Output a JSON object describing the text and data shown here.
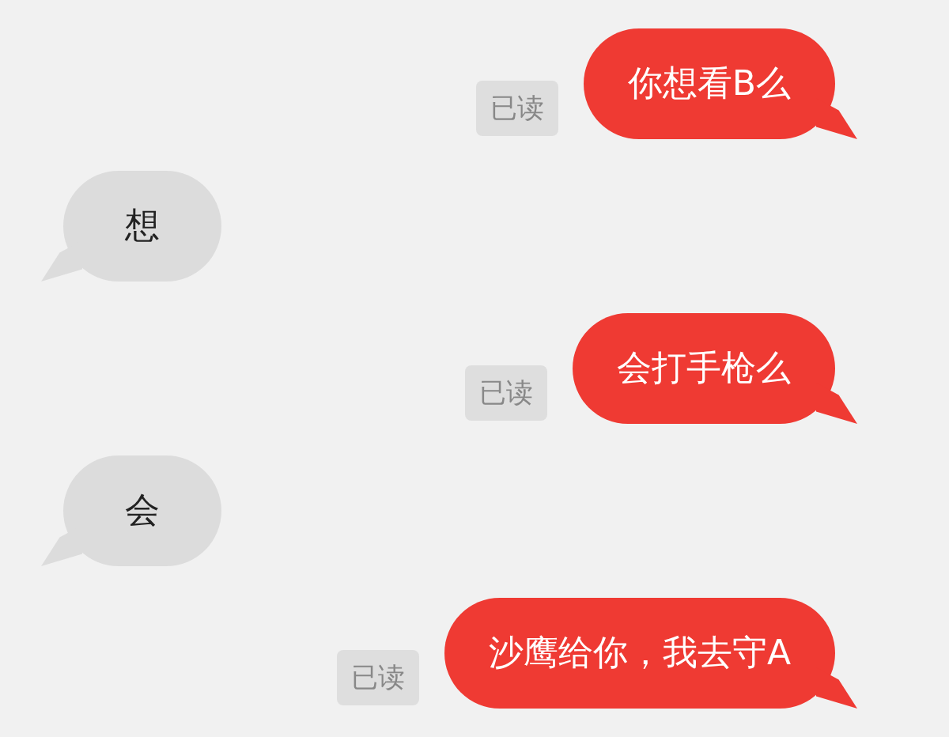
{
  "messages": [
    {
      "kind": "outgoing",
      "text": "你想看B么",
      "receipt": "已读"
    },
    {
      "kind": "incoming",
      "text": "想"
    },
    {
      "kind": "outgoing",
      "text": "会打手枪么",
      "receipt": "已读"
    },
    {
      "kind": "incoming",
      "text": "会"
    },
    {
      "kind": "outgoing",
      "text": "沙鹰给你，我去守A",
      "receipt": "已读"
    }
  ]
}
